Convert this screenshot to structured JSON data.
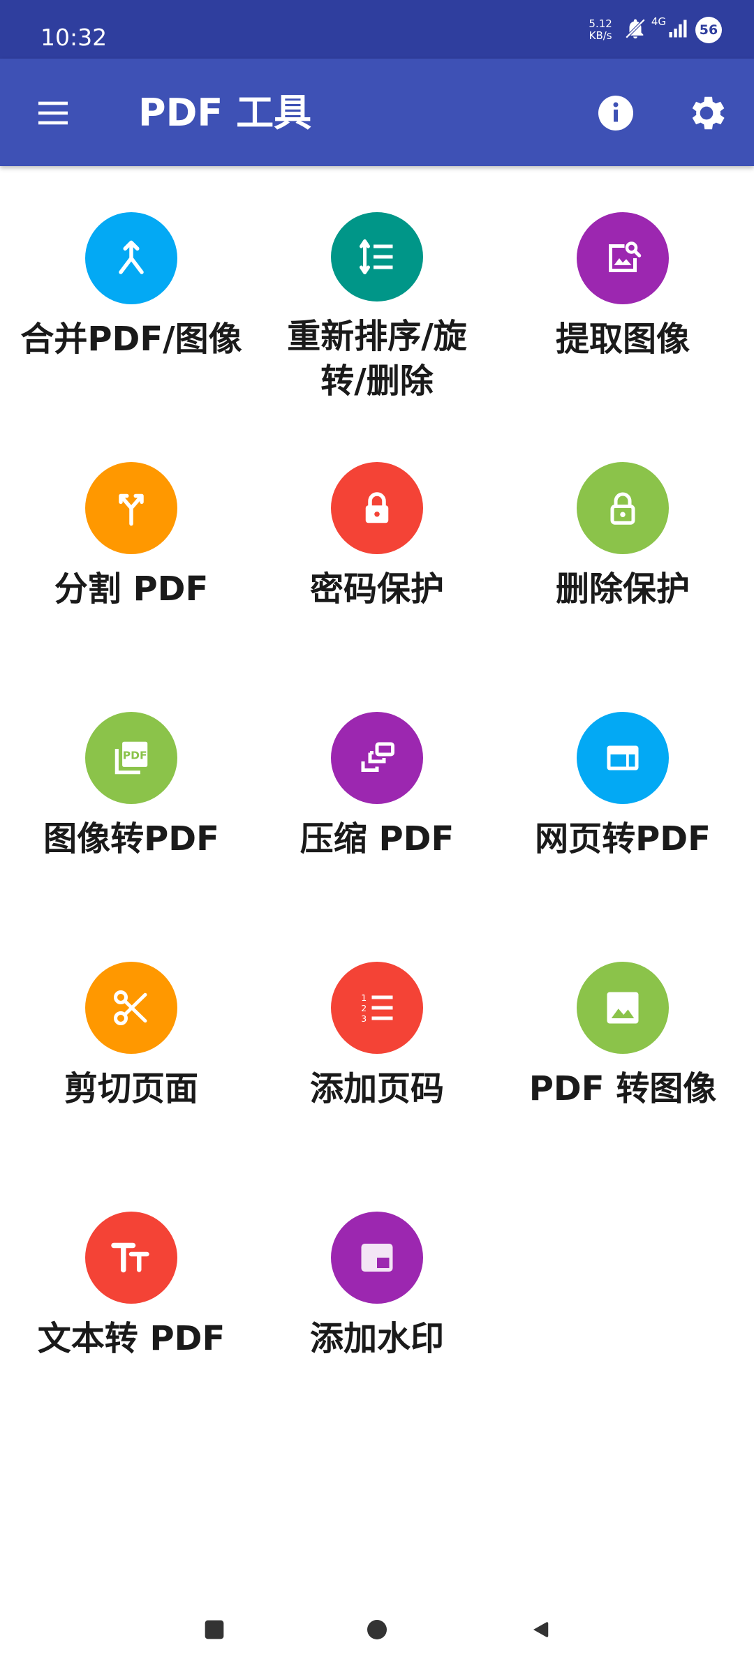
{
  "status_bar": {
    "time": "10:32",
    "net_speed_value": "5.12",
    "net_speed_unit": "KB/s",
    "network_type": "4G",
    "battery": "56"
  },
  "app_bar": {
    "title": "PDF 工具",
    "menu_icon": "hamburger-menu-icon",
    "info_icon": "info-icon",
    "settings_icon": "gear-icon"
  },
  "tools": [
    {
      "label": "合并PDF/图像",
      "color": "#03a9f4",
      "icon": "merge-icon"
    },
    {
      "label": "重新排序/旋转/删除",
      "color": "#009688",
      "icon": "reorder-icon"
    },
    {
      "label": "提取图像",
      "color": "#9c27b0",
      "icon": "image-search-icon"
    },
    {
      "label": "分割 PDF",
      "color": "#ff9800",
      "icon": "split-icon"
    },
    {
      "label": "密码保护",
      "color": "#f44336",
      "icon": "lock-icon"
    },
    {
      "label": "删除保护",
      "color": "#8bc34a",
      "icon": "unlock-icon"
    },
    {
      "label": "图像转PDF",
      "color": "#8bc34a",
      "icon": "pdf-images-icon"
    },
    {
      "label": "压缩 PDF",
      "color": "#9c27b0",
      "icon": "compress-icon"
    },
    {
      "label": "网页转PDF",
      "color": "#03a9f4",
      "icon": "web-page-icon"
    },
    {
      "label": "剪切页面",
      "color": "#ff9800",
      "icon": "scissors-icon"
    },
    {
      "label": "添加页码",
      "color": "#f44336",
      "icon": "numbered-list-icon"
    },
    {
      "label": "PDF 转图像",
      "color": "#8bc34a",
      "icon": "image-icon"
    },
    {
      "label": "文本转 PDF",
      "color": "#f44336",
      "icon": "text-size-icon"
    },
    {
      "label": "添加水印",
      "color": "#9c27b0",
      "icon": "watermark-icon"
    }
  ],
  "nav_bar": {
    "recents_icon": "square-recents-icon",
    "home_icon": "circle-home-icon",
    "back_icon": "triangle-back-icon"
  }
}
